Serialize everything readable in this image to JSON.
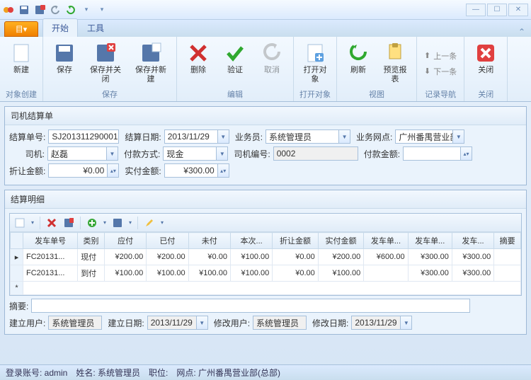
{
  "qat": {
    "undo_color": "#8899aa",
    "redo_color": "#2fa82f"
  },
  "tabs": {
    "app": "目▾",
    "start": "开始",
    "tools": "工具"
  },
  "ribbon": {
    "g1": {
      "label": "对象创建",
      "new": "新建"
    },
    "g2": {
      "label": "保存",
      "save": "保存",
      "save_close": "保存并关闭",
      "save_new": "保存并新建"
    },
    "g3": {
      "label": "编辑",
      "delete": "删除",
      "validate": "验证",
      "cancel": "取消"
    },
    "g4": {
      "label": "打开对象",
      "open": "打开对象"
    },
    "g5": {
      "label": "视图",
      "refresh": "刷新",
      "preview": "预览报表"
    },
    "g6": {
      "label": "记录导航",
      "prev": "上一条",
      "next": "下一条"
    },
    "g7": {
      "label": "关闭",
      "close": "关闭"
    }
  },
  "panel1": {
    "title": "司机结算单",
    "bill_no_lbl": "结算单号:",
    "bill_no": "SJ201311290001",
    "bill_date_lbl": "结算日期:",
    "bill_date": "2013/11/29",
    "clerk_lbl": "业务员:",
    "clerk": "系统管理员",
    "branch_lbl": "业务网点:",
    "branch": "广州番禺营业部",
    "driver_lbl": "司机:",
    "driver": "赵磊",
    "pay_method_lbl": "付款方式:",
    "pay_method": "现金",
    "driver_no_lbl": "司机编号:",
    "driver_no": "0002",
    "pay_amt_lbl": "付款金额:",
    "pay_amt": "",
    "discount_lbl": "折让金额:",
    "discount": "¥0.00",
    "actual_lbl": "实付金额:",
    "actual": "¥300.00"
  },
  "panel2": {
    "title": "结算明细",
    "headers": [
      "发车单号",
      "类别",
      "应付",
      "已付",
      "未付",
      "本次...",
      "折让金额",
      "实付金额",
      "发车单...",
      "发车单...",
      "发车...",
      "摘要"
    ],
    "rows": [
      {
        "h": "▸",
        "c": [
          "FC20131...",
          "现付",
          "¥200.00",
          "¥200.00",
          "¥0.00",
          "¥100.00",
          "¥0.00",
          "¥200.00",
          "¥600.00",
          "¥300.00",
          "¥300.00",
          ""
        ]
      },
      {
        "h": "",
        "c": [
          "FC20131...",
          "到付",
          "¥100.00",
          "¥100.00",
          "¥100.00",
          "¥100.00",
          "¥0.00",
          "¥100.00",
          "",
          "¥300.00",
          "¥300.00",
          ""
        ]
      }
    ]
  },
  "footer": {
    "summary_lbl": "摘要:",
    "create_user_lbl": "建立用户:",
    "create_user": "系统管理员",
    "create_date_lbl": "建立日期:",
    "create_date": "2013/11/29",
    "modify_user_lbl": "修改用户:",
    "modify_user": "系统管理员",
    "modify_date_lbl": "修改日期:",
    "modify_date": "2013/11/29"
  },
  "status": {
    "login": "登录账号: admin",
    "name": "姓名: 系统管理员",
    "role": "职位:",
    "branch": "网点: 广州番禺营业部(总部)"
  }
}
